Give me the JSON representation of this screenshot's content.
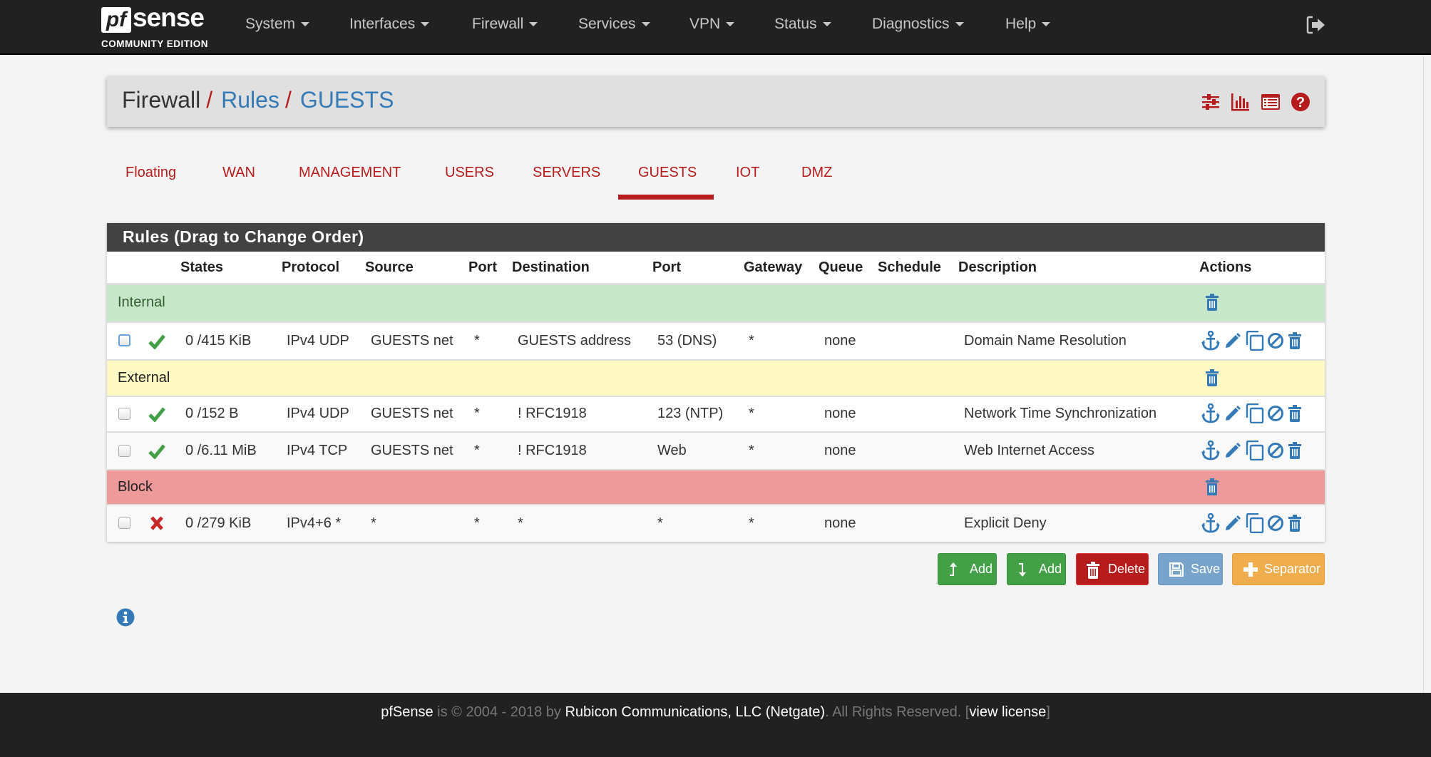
{
  "navbar": {
    "logo_pf": "pf",
    "logo_sense": "sense",
    "logo_edition": "COMMUNITY EDITION",
    "menu": [
      {
        "label": "System"
      },
      {
        "label": "Interfaces"
      },
      {
        "label": "Firewall"
      },
      {
        "label": "Services"
      },
      {
        "label": "VPN"
      },
      {
        "label": "Status"
      },
      {
        "label": "Diagnostics"
      },
      {
        "label": "Help"
      }
    ],
    "logout_icon": "sign-out-icon"
  },
  "breadcrumb": {
    "items": [
      "Firewall",
      "Rules",
      "GUESTS"
    ],
    "separator": "/",
    "icons": [
      "sliders-icon",
      "bar-chart-icon",
      "list-alt-icon",
      "question-circle-icon"
    ]
  },
  "tabs": {
    "items": [
      {
        "label": "Floating"
      },
      {
        "label": "WAN"
      },
      {
        "label": "MANAGEMENT"
      },
      {
        "label": "USERS"
      },
      {
        "label": "SERVERS"
      },
      {
        "label": "GUESTS",
        "active": true
      },
      {
        "label": "IOT"
      },
      {
        "label": "DMZ"
      }
    ]
  },
  "rules_panel": {
    "title": "Rules (Drag to Change Order)",
    "columns": [
      "States",
      "Protocol",
      "Source",
      "Port",
      "Destination",
      "Port",
      "Gateway",
      "Queue",
      "Schedule",
      "Description",
      "Actions"
    ],
    "separators": [
      {
        "label": "Internal",
        "color": "#c8e6c9"
      },
      {
        "label": "External",
        "color": "#fff9c4"
      },
      {
        "label": "Block",
        "color": "#ef9a9a"
      }
    ],
    "rules": [
      {
        "action": "pass",
        "states": "0 /415 KiB",
        "protocol": "IPv4 UDP",
        "source": "GUESTS net",
        "source_port": "*",
        "destination": "GUESTS address",
        "dest_port": "53 (DNS)",
        "gateway": "*",
        "queue": "none",
        "schedule": "",
        "description": "Domain Name Resolution"
      },
      {
        "action": "pass",
        "states": "0 /152 B",
        "protocol": "IPv4 UDP",
        "source": "GUESTS net",
        "source_port": "*",
        "destination": "! RFC1918",
        "dest_port": "123 (NTP)",
        "gateway": "*",
        "queue": "none",
        "schedule": "",
        "description": "Network Time Synchronization"
      },
      {
        "action": "pass",
        "states": "0 /6.11 MiB",
        "protocol": "IPv4 TCP",
        "source": "GUESTS net",
        "source_port": "*",
        "destination": "! RFC1918",
        "dest_port": "Web",
        "gateway": "*",
        "queue": "none",
        "schedule": "",
        "description": "Web Internet Access"
      },
      {
        "action": "block",
        "states": "0 /279 KiB",
        "protocol": "IPv4+6 *",
        "source": "*",
        "source_port": "*",
        "destination": "*",
        "dest_port": "*",
        "gateway": "*",
        "queue": "none",
        "schedule": "",
        "description": "Explicit Deny"
      }
    ]
  },
  "buttons": {
    "add_top": "Add",
    "add_bottom": "Add",
    "delete": "Delete",
    "save": "Save",
    "separator": "Separator"
  },
  "colors": {
    "brand_red": "#b71c1c",
    "link_blue": "#337ab7",
    "success_green": "#43a047",
    "save_blue": "#78a4cc",
    "separator_orange": "#f0ad4e"
  },
  "footer": {
    "product": "pfSense",
    "copyright": " is © 2004 - 2018 by ",
    "company": "Rubicon Communications, LLC (Netgate)",
    "rights": ". All Rights Reserved. [",
    "license_link": "view license",
    "close": "]"
  }
}
